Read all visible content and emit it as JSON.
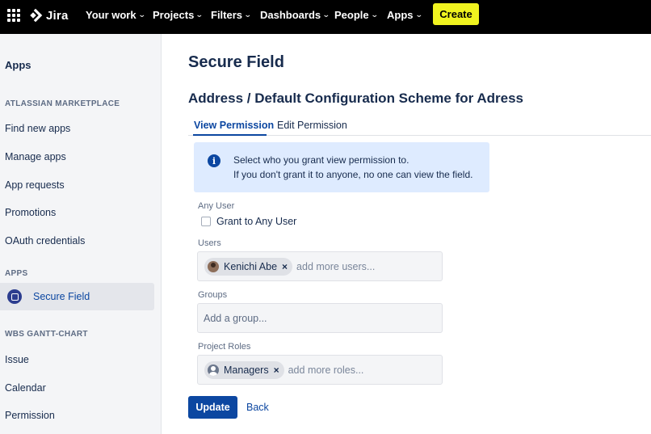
{
  "topnav": {
    "logo_text": "Jira",
    "items": [
      {
        "label": "Your work"
      },
      {
        "label": "Projects"
      },
      {
        "label": "Filters"
      },
      {
        "label": "Dashboards"
      },
      {
        "label": "People"
      },
      {
        "label": "Apps"
      }
    ],
    "create_label": "Create",
    "colors": {
      "bar": "#000000",
      "create": "#f0f31f"
    }
  },
  "sidebar": {
    "title": "Apps",
    "sections": [
      {
        "heading": "ATLASSIAN MARKETPLACE",
        "items": [
          "Find new apps",
          "Manage apps",
          "App requests",
          "Promotions",
          "OAuth credentials"
        ]
      },
      {
        "heading": "APPS",
        "items": [
          "Secure Field"
        ]
      },
      {
        "heading": "WBS GANTT-CHART",
        "items": [
          "Issue",
          "Calendar",
          "Permission"
        ]
      }
    ]
  },
  "main": {
    "title": "Secure Field",
    "subtitle": "Address / Default Configuration Scheme for Adress",
    "tabs": [
      {
        "label": "View Permission",
        "active": true
      },
      {
        "label": "Edit Permission",
        "active": false
      }
    ],
    "info": {
      "line1": "Select who you grant view permission to.",
      "line2": "If you don't grant it to anyone, no one can view the field."
    },
    "any_user": {
      "label": "Any User",
      "checkbox_label": "Grant to Any User",
      "checked": false
    },
    "users": {
      "label": "Users",
      "chips": [
        "Kenichi Abe"
      ],
      "placeholder": "add more users..."
    },
    "groups": {
      "label": "Groups",
      "placeholder": "Add a group..."
    },
    "project_roles": {
      "label": "Project Roles",
      "chips": [
        "Managers"
      ],
      "placeholder": "add more roles..."
    },
    "update_label": "Update",
    "back_label": "Back",
    "colors": {
      "primary": "#0c47a1",
      "info_bg": "#deebff"
    }
  }
}
